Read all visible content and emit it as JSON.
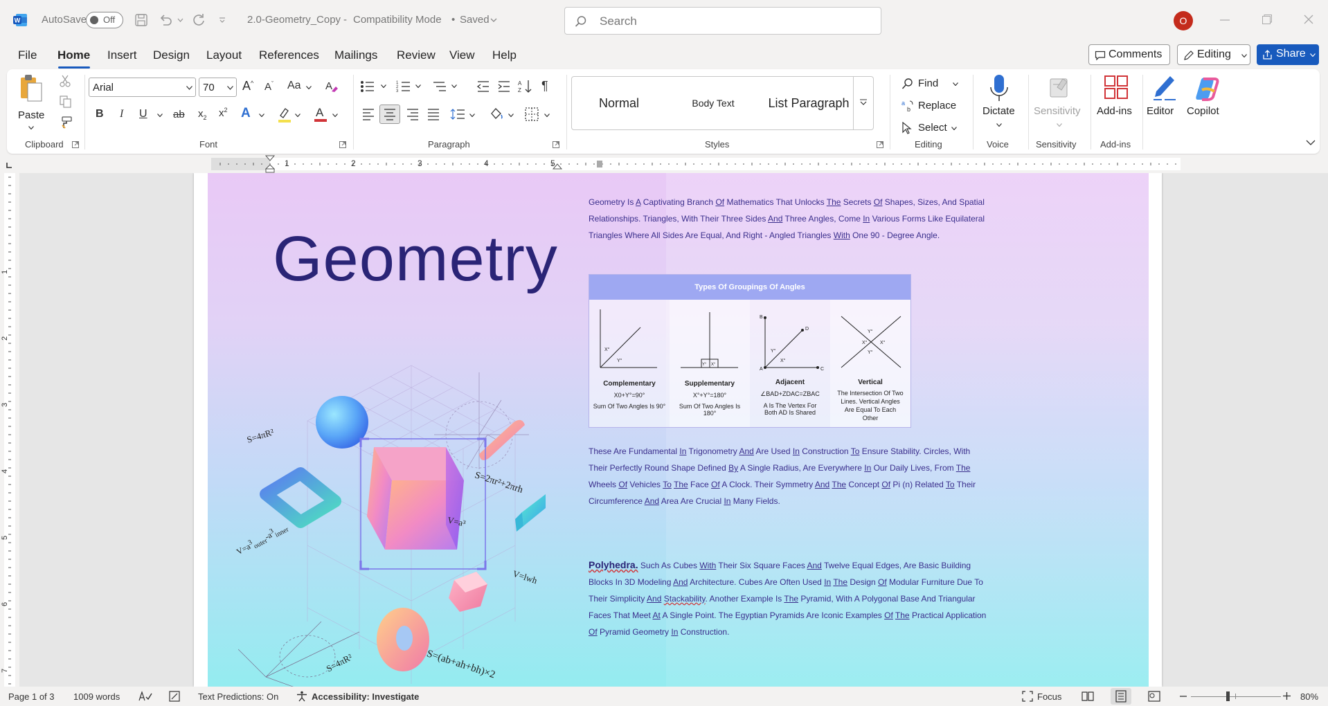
{
  "titlebar": {
    "autosave_label": "AutoSave",
    "autosave_state": "Off",
    "doc_title": "2.0-Geometry_Copy",
    "mode": "Compatibility Mode",
    "saved": "Saved",
    "search_placeholder": "Search",
    "avatar_initial": "O",
    "colors": {
      "accent": "#185abd",
      "avatar": "#c42b1c"
    }
  },
  "menu": {
    "items": [
      "File",
      "Home",
      "Insert",
      "Design",
      "Layout",
      "References",
      "Mailings",
      "Review",
      "View",
      "Help"
    ],
    "active": "Home",
    "comments": "Comments",
    "editing": "Editing",
    "share": "Share"
  },
  "ribbon": {
    "clipboard": {
      "paste": "Paste",
      "label": "Clipboard"
    },
    "font": {
      "name": "Arial",
      "size": "70",
      "change_case": "Aa",
      "label": "Font"
    },
    "paragraph": {
      "label": "Paragraph"
    },
    "styles": {
      "items": [
        "Normal",
        "Body Text",
        "List Paragraph"
      ],
      "label": "Styles"
    },
    "editing": {
      "find": "Find",
      "replace": "Replace",
      "select": "Select",
      "label": "Editing"
    },
    "voice": {
      "dictate": "Dictate",
      "label": "Voice"
    },
    "sensitivity": {
      "button": "Sensitivity",
      "label": "Sensitivity"
    },
    "addins": {
      "button": "Add-ins",
      "label": "Add-ins"
    },
    "editor": "Editor",
    "copilot": "Copilot"
  },
  "ruler": {
    "numbers": [
      "1",
      "2",
      "3",
      "4",
      "5"
    ],
    "vnumbers": [
      "1",
      "2",
      "3",
      "4",
      "5",
      "6",
      "7"
    ]
  },
  "document": {
    "title": "Geometry",
    "formulas": [
      "S=4πR²",
      "S=2πr²+2πrh",
      "V=a³",
      "V=lwh",
      "S=4πR²",
      "S=(ab+ah+bh)×2"
    ],
    "para1": {
      "parts": [
        "Geometry Is ",
        "A",
        " Captivating Branch ",
        "Of",
        " Mathematics That Unlocks ",
        "The",
        " Secrets ",
        "Of",
        " Shapes, Sizes, And Spatial Relationships. Triangles, With Their Three Sides ",
        "And",
        " Three Angles, Come ",
        "In",
        " Various Forms Like Equilateral Triangles Where All Sides Are Equal, And Right - Angled Triangles ",
        "With",
        " One 90 - Degree Angle."
      ]
    },
    "table": {
      "header": "Types Of Groupings Of Angles",
      "cards": [
        {
          "title": "Complementary",
          "formula": "X0+Y°=90°",
          "desc": "Sum Of Two Angles Is 90°"
        },
        {
          "title": "Supplementary",
          "formula": "X°+Y°=180°",
          "desc": "Sum Of Two Angles Is 180°"
        },
        {
          "title": "Adjacent",
          "formula": "∠BAD+ZDAC=ZBAC",
          "desc": "A Is The Vertex For Both AD Is Shared"
        },
        {
          "title": "Vertical",
          "formula": "",
          "desc": "The Intersection Of Two Lines. Vertical Angles Are Equal To Each Other"
        }
      ],
      "point_labels": {
        "B": "B",
        "D": "D",
        "A": "A",
        "C": "C",
        "X": "X°",
        "Y": "Y°"
      }
    },
    "para2": {
      "parts": [
        "These Are Fundamental ",
        "In",
        " Trigonometry ",
        "And",
        " Are Used ",
        "In",
        " Construction ",
        "To",
        " Ensure Stability. Circles, With Their Perfectly Round Shape Defined ",
        "By",
        " A Single Radius, Are Everywhere ",
        "In",
        " Our Daily Lives, From ",
        "The",
        " Wheels ",
        "Of",
        " Vehicles ",
        "To",
        " ",
        "The",
        " Face ",
        "Of",
        " A Clock. Their Symmetry ",
        "And",
        " ",
        "The",
        " Concept ",
        "Of",
        " Pi (n) Related ",
        "To",
        " Their Circumference ",
        "And",
        " Area Are Crucial ",
        "In",
        " Many Fields."
      ]
    },
    "para3": {
      "lead": "Polyhedra.",
      "parts": [
        " Such As Cubes ",
        "With",
        " Their Six Square Faces ",
        "And",
        " Twelve Equal Edges, Are Basic Building Blocks In 3D Modeling ",
        "And",
        " Architecture. Cubes Are Often Used ",
        "In",
        " ",
        "The",
        " Design ",
        "Of",
        " Modular Furniture Due To Their Simplicity ",
        "And",
        " ",
        "Stackability",
        ". Another Example Is ",
        "The",
        " Pyramid, With A Polygonal Base And Triangular Faces That Meet ",
        "At",
        " A Single Point. The Egyptian Pyramids Are Iconic Examples ",
        "Of",
        " ",
        "The",
        " Practical Application ",
        "Of",
        " Pyramid Geometry ",
        "In",
        " Construction."
      ]
    }
  },
  "status": {
    "page": "Page 1 of 3",
    "words": "1009 words",
    "text_predictions": "Text Predictions: On",
    "accessibility": "Accessibility: Investigate",
    "focus": "Focus",
    "zoom": "80%"
  }
}
